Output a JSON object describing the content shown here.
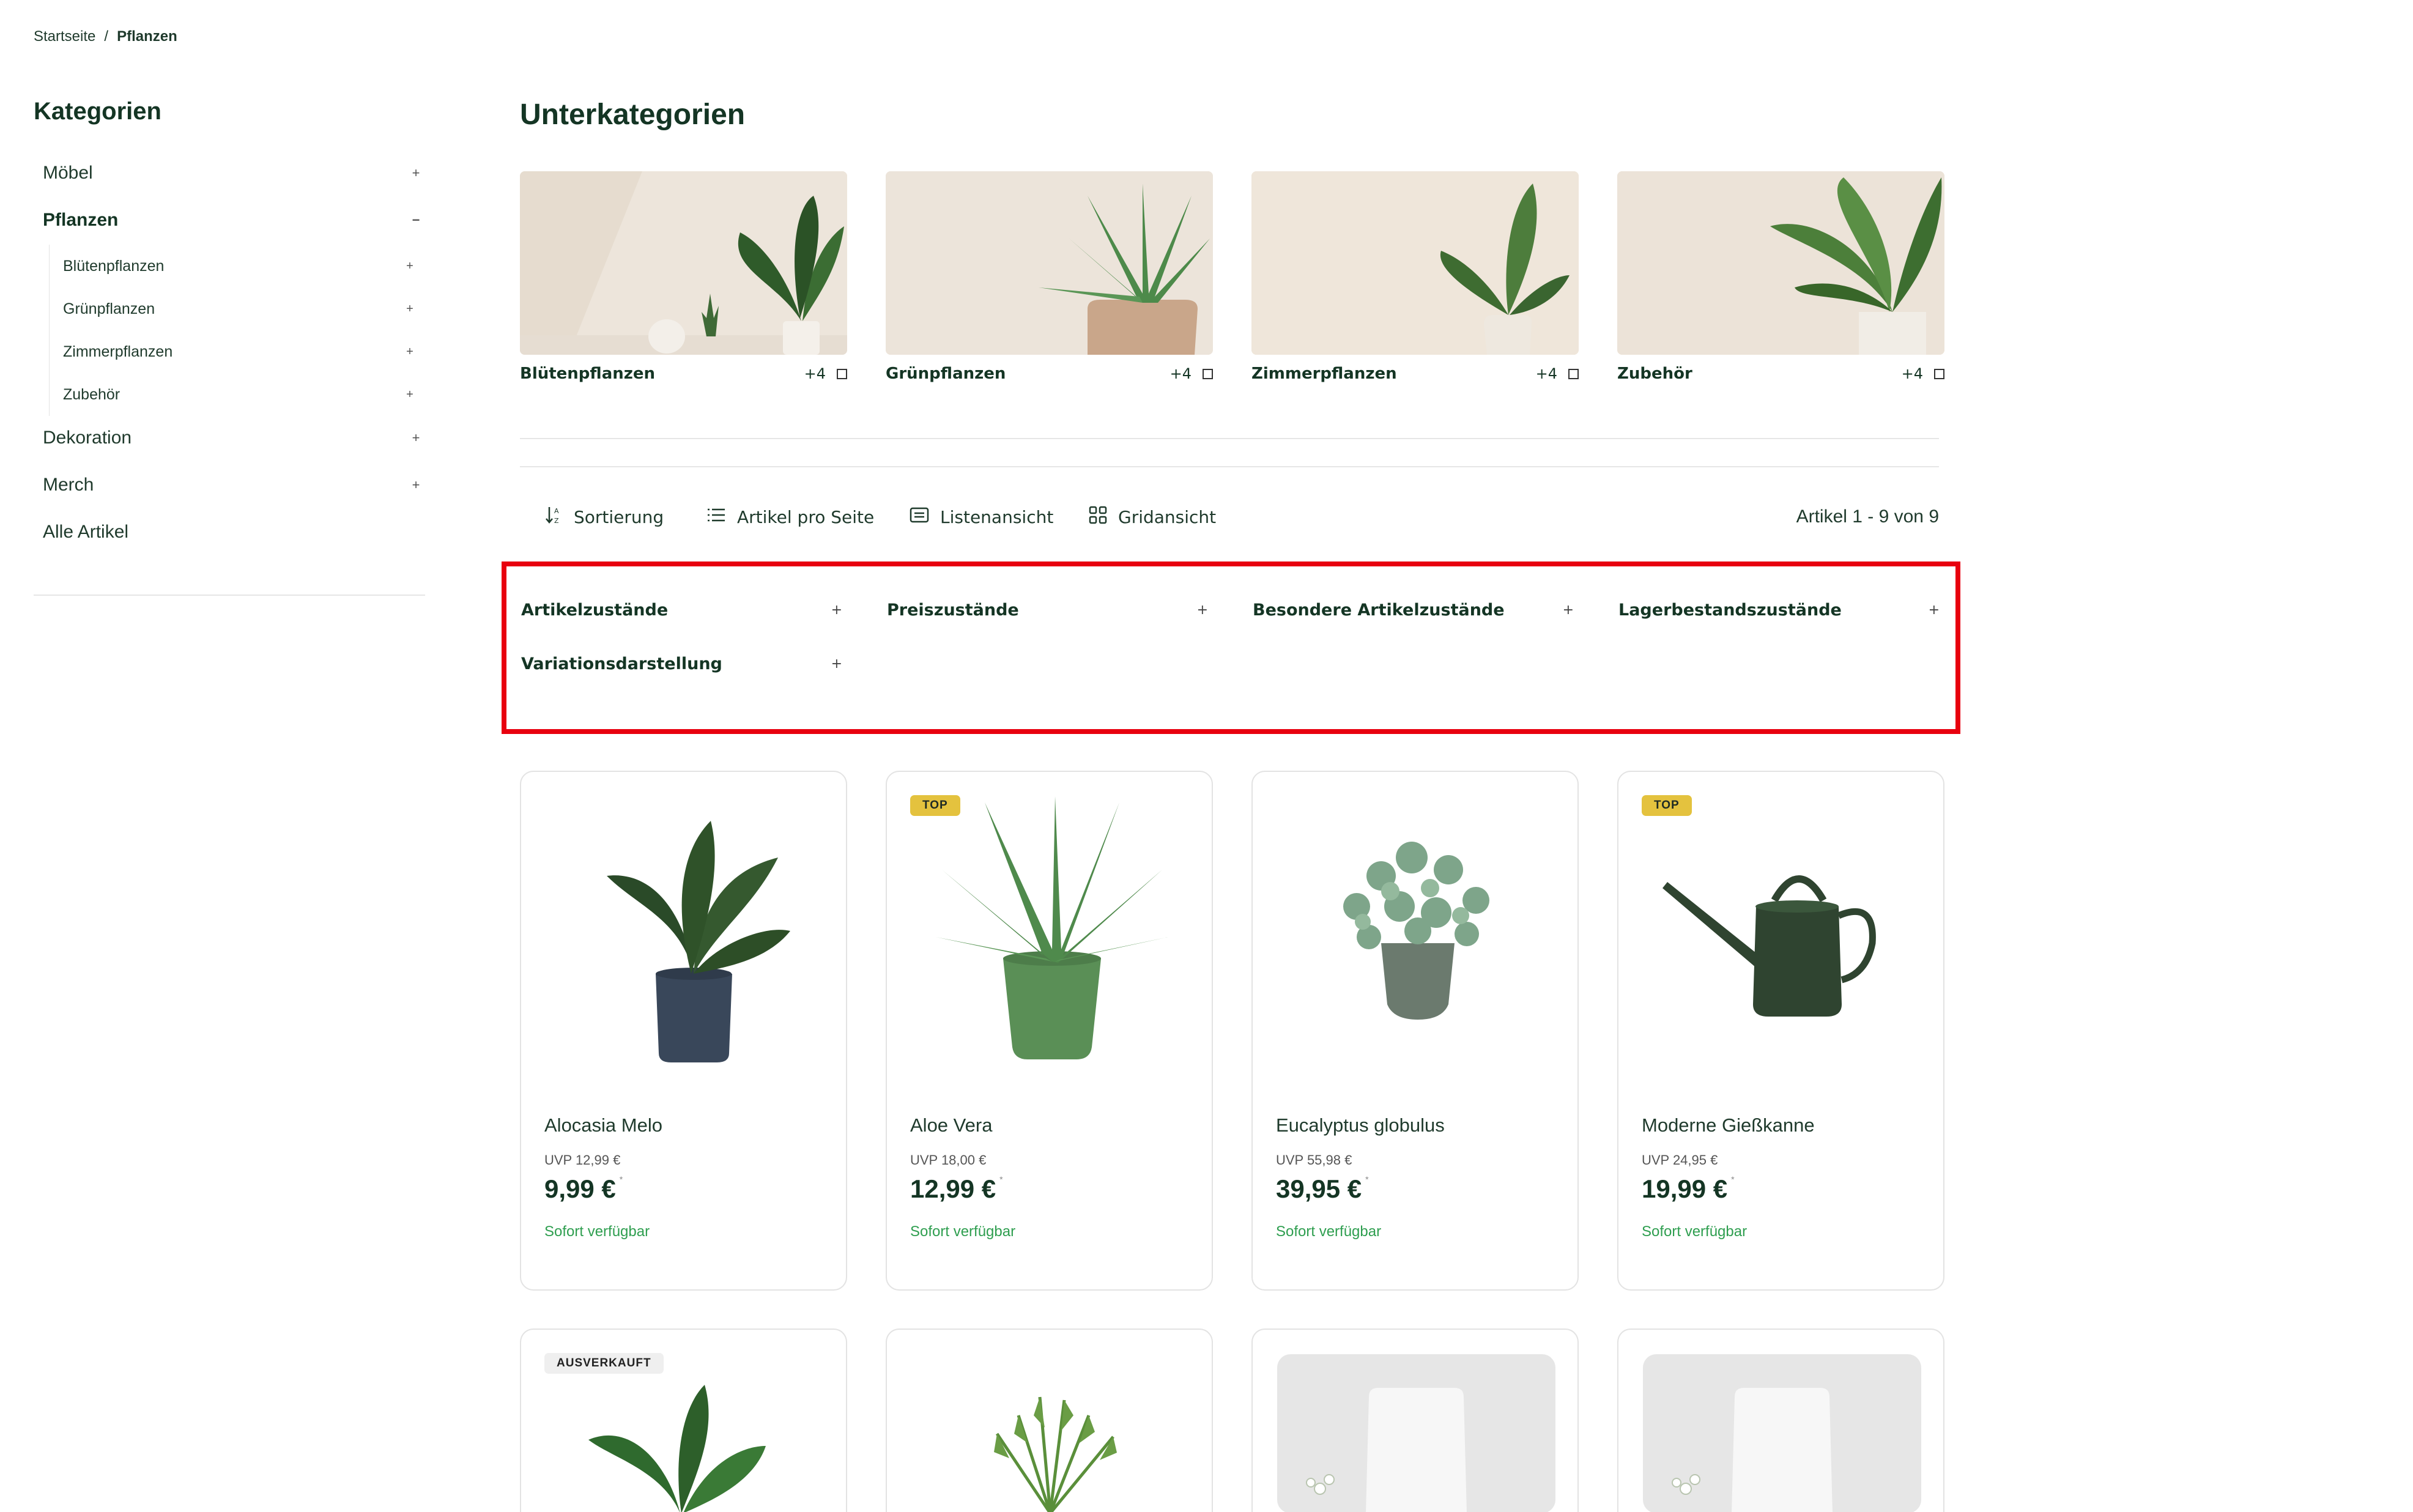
{
  "breadcrumb": {
    "home": "Startseite",
    "separator": "/",
    "current": "Pflanzen"
  },
  "sidebar": {
    "title": "Kategorien",
    "items": [
      {
        "label": "Möbel",
        "toggle": "+"
      },
      {
        "label": "Pflanzen",
        "toggle": "−"
      },
      {
        "label": "Dekoration",
        "toggle": "+"
      },
      {
        "label": "Merch",
        "toggle": "+"
      },
      {
        "label": "Alle Artikel",
        "toggle": ""
      }
    ],
    "subitems": [
      {
        "label": "Blütenpflanzen",
        "toggle": "+"
      },
      {
        "label": "Grünpflanzen",
        "toggle": "+"
      },
      {
        "label": "Zimmerpflanzen",
        "toggle": "+"
      },
      {
        "label": "Zubehör",
        "toggle": "+"
      }
    ]
  },
  "main": {
    "title": "Unterkategorien",
    "subcategories": [
      {
        "name": "Blütenpflanzen",
        "extra": "+4"
      },
      {
        "name": "Grünpflanzen",
        "extra": "+4"
      },
      {
        "name": "Zimmerpflanzen",
        "extra": "+4"
      },
      {
        "name": "Zubehör",
        "extra": "+4"
      }
    ]
  },
  "toolbar": {
    "sort": "Sortierung",
    "per_page": "Artikel pro Seite",
    "list_view": "Listenansicht",
    "grid_view": "Gridansicht",
    "count": "Artikel 1 - 9 von 9"
  },
  "filters": [
    {
      "label": "Artikelzustände",
      "toggle": "+"
    },
    {
      "label": "Preiszustände",
      "toggle": "+"
    },
    {
      "label": "Besondere Artikelzustände",
      "toggle": "+"
    },
    {
      "label": "Lagerbestandszustände",
      "toggle": "+"
    },
    {
      "label": "Variationsdarstellung",
      "toggle": "+"
    }
  ],
  "products": [
    {
      "name": "Alocasia Melo",
      "uvp": "UVP 12,99 €",
      "price": "9,99 €",
      "star": "*",
      "availability": "Sofort verfügbar",
      "badge": ""
    },
    {
      "name": "Aloe Vera",
      "uvp": "UVP 18,00 €",
      "price": "12,99 €",
      "star": "*",
      "availability": "Sofort verfügbar",
      "badge": "TOP"
    },
    {
      "name": "Eucalyptus globulus",
      "uvp": "UVP 55,98 €",
      "price": "39,95 €",
      "star": "*",
      "availability": "Sofort verfügbar",
      "badge": ""
    },
    {
      "name": "Moderne Gießkanne",
      "uvp": "UVP 24,95 €",
      "price": "19,99 €",
      "star": "*",
      "availability": "Sofort verfügbar",
      "badge": "TOP"
    }
  ],
  "products_row2": [
    {
      "badge": "AUSVERKAUFT"
    }
  ],
  "colors": {
    "accent_red": "#e8000f",
    "badge_top": "#e4c23e",
    "availability_green": "#2e9e4f",
    "text_dark_green": "#143524"
  },
  "icons": [
    "sort-icon",
    "list-icon",
    "list-view-icon",
    "grid-view-icon"
  ]
}
